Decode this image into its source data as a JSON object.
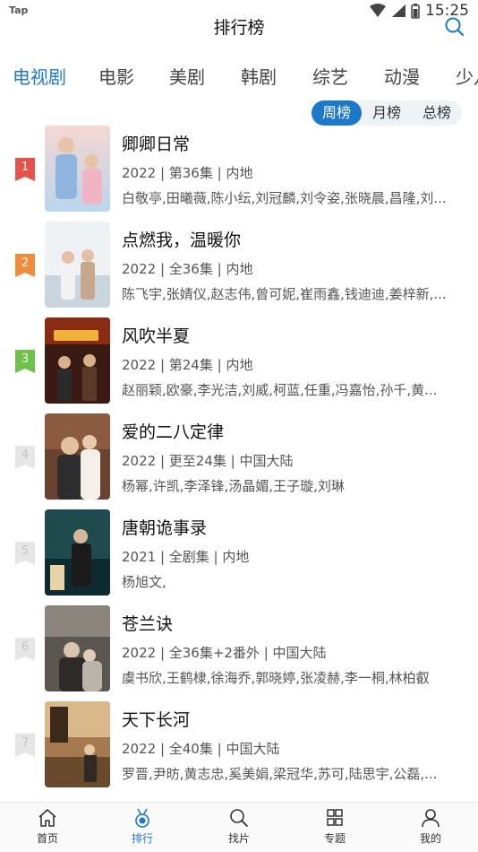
{
  "status_bar": {
    "left": "Tap",
    "time": "15:25"
  },
  "header": {
    "title": "排行榜"
  },
  "tabs": [
    {
      "label": "电视剧",
      "active": true
    },
    {
      "label": "电影"
    },
    {
      "label": "美剧"
    },
    {
      "label": "韩剧"
    },
    {
      "label": "综艺"
    },
    {
      "label": "动漫"
    },
    {
      "label": "少儿"
    }
  ],
  "segments": [
    {
      "label": "周榜",
      "active": true
    },
    {
      "label": "月榜"
    },
    {
      "label": "总榜"
    }
  ],
  "rank_colors": {
    "1": "#e5534b",
    "2": "#f08c3a",
    "3": "#6cc24a",
    "other": "#e6e6e6"
  },
  "accent": "#1e78c8",
  "items": [
    {
      "rank": "1",
      "title": "卿卿日常",
      "meta": "2022 | 第36集 | 内地",
      "cast": "白敬亭,田曦薇,陈小纭,刘冠麟,刘令姿,张晓晨,昌隆,刘..."
    },
    {
      "rank": "2",
      "title": "点燃我，温暖你",
      "meta": "2022 | 全36集 | 内地",
      "cast": "陈飞宇,张婧仪,赵志伟,曾可妮,崔雨鑫,钱迪迪,姜梓新,..."
    },
    {
      "rank": "3",
      "title": "风吹半夏",
      "meta": "2022 | 第24集 | 内地",
      "cast": "赵丽颖,欧豪,李光洁,刘威,柯蓝,任重,冯嘉怡,孙千,黄..."
    },
    {
      "rank": "4",
      "title": "爱的二八定律",
      "meta": "2022 | 更至24集 | 中国大陆",
      "cast": "杨幂,许凯,李泽锋,汤晶媚,王子璇,刘琳"
    },
    {
      "rank": "5",
      "title": "唐朝诡事录",
      "meta": "2021 | 全剧集 | 内地",
      "cast": "杨旭文,"
    },
    {
      "rank": "6",
      "title": "苍兰诀",
      "meta": "2022 | 全36集+2番外 | 中国大陆",
      "cast": "虞书欣,王鹤棣,徐海乔,郭晓婷,张凌赫,李一桐,林柏叡"
    },
    {
      "rank": "7",
      "title": "天下长河",
      "meta": "2022 | 全40集 | 中国大陆",
      "cast": "罗晋,尹昉,黄志忠,奚美娟,梁冠华,苏可,陆思宇,公磊,..."
    }
  ],
  "bottom_nav": [
    {
      "label": "首页",
      "icon": "home-icon"
    },
    {
      "label": "排行",
      "icon": "medal-icon",
      "active": true
    },
    {
      "label": "找片",
      "icon": "search-icon"
    },
    {
      "label": "专题",
      "icon": "grid-icon"
    },
    {
      "label": "我的",
      "icon": "user-icon"
    }
  ]
}
